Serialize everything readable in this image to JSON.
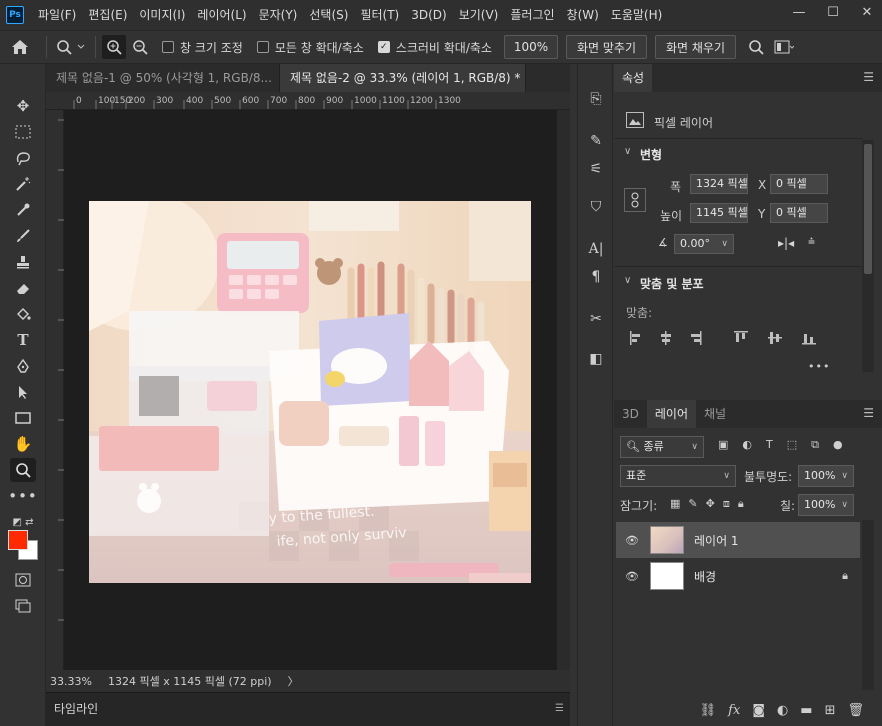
{
  "app": {
    "logo": "Ps"
  },
  "menu": [
    "파일(F)",
    "편집(E)",
    "이미지(I)",
    "레이어(L)",
    "문자(Y)",
    "선택(S)",
    "필터(T)",
    "3D(D)",
    "보기(V)",
    "플러그인",
    "창(W)",
    "도움말(H)"
  ],
  "window_controls": {
    "minimize": "—",
    "maximize": "☐",
    "close": "✕"
  },
  "options": {
    "resize_window": "창 크기 조정",
    "zoom_all": "모든 창 확대/축소",
    "scrubby_zoom": "스크러비 확대/축소",
    "zoom_value": "100%",
    "fit_screen": "화면 맞추기",
    "fill_screen": "화면 채우기"
  },
  "tabs": [
    {
      "label": "제목 없음-1 @ 50% (사각형 1, RGB/8...",
      "active": false
    },
    {
      "label": "제목 없음-2 @ 33.3% (레이어 1, RGB/8) *",
      "active": true
    }
  ],
  "tab_close": "×",
  "ruler": {
    "h_ticks": [
      "0",
      "100",
      "150",
      "200",
      "300",
      "400",
      "500",
      "600",
      "700",
      "800",
      "900",
      "1000",
      "1100",
      "1200",
      "1300"
    ]
  },
  "status": {
    "zoom": "33.33%",
    "doc_info": "1324 픽셀 x 1145 픽셀 (72 ppi)",
    "arrow": "〉"
  },
  "timeline": {
    "label": "타임라인"
  },
  "properties": {
    "tab": "속성",
    "kind": "픽셀 레이어",
    "transform_title": "변형",
    "w_label": "폭",
    "w_value": "1324 픽셀",
    "h_label": "높이",
    "h_value": "1145 픽셀",
    "x_label": "X",
    "x_value": "0 픽셀",
    "y_label": "Y",
    "y_value": "0 픽셀",
    "angle_value": "0.00°",
    "align_title": "맞춤 및 분포",
    "align_label": "맞춤:",
    "more": "•••"
  },
  "layers_panel": {
    "tabs": [
      "3D",
      "레이어",
      "채널"
    ],
    "active_tab": "레이어",
    "filter_kind": "종류",
    "blend_mode": "표준",
    "opacity_label": "불투명도:",
    "opacity_value": "100%",
    "lock_label": "잠그기:",
    "fill_label": "칠:",
    "fill_value": "100%",
    "layers": [
      {
        "name": "레이어 1",
        "selected": true
      },
      {
        "name": "배경",
        "selected": false
      }
    ]
  },
  "colors": {
    "foreground": "#ff2a00",
    "background": "#ffffff",
    "accent": "#31a8ff"
  },
  "icons": [
    "home-icon",
    "zoom-icon",
    "zoom-in-icon",
    "zoom-out-icon",
    "search-icon",
    "eye-icon",
    "lock-icon",
    "link-icon",
    "fx-icon",
    "trash-icon"
  ]
}
